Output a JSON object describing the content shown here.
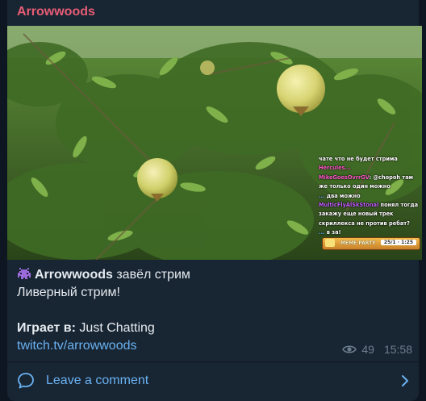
{
  "channel": {
    "name": "Arrowwoods"
  },
  "stream_preview": {
    "chat_overlay": [
      {
        "user": "",
        "text": "чате что не будет стрима"
      },
      {
        "user": "Hercules...",
        "text": ""
      },
      {
        "user": "MikeGoesOvrrGV",
        "text": ": @chopoh там же только один можно"
      },
      {
        "user": "...",
        "text": " два можно"
      },
      {
        "user": "MulticFlyAlSkStonal",
        "text": " понял тогда закажу еще новый трек скриллекса не против ребат?"
      },
      {
        "user": "...",
        "text": " в за!"
      }
    ],
    "meme_party": {
      "label": "MEME PARTY",
      "counter": "25/1 · 1:25"
    }
  },
  "post": {
    "streamer": "Arrowwoods",
    "action": "завёл стрим",
    "title": "Ливерный стрим!",
    "playing_label": "Играет в:",
    "game": "Just Chatting",
    "link": "twitch.tv/arrowwoods"
  },
  "meta": {
    "views": "49",
    "time": "15:58"
  },
  "comments": {
    "label": "Leave a comment"
  },
  "colors": {
    "accent": "#6ab2f2",
    "channel_name": "#e85d75",
    "bubble": "#182533"
  }
}
